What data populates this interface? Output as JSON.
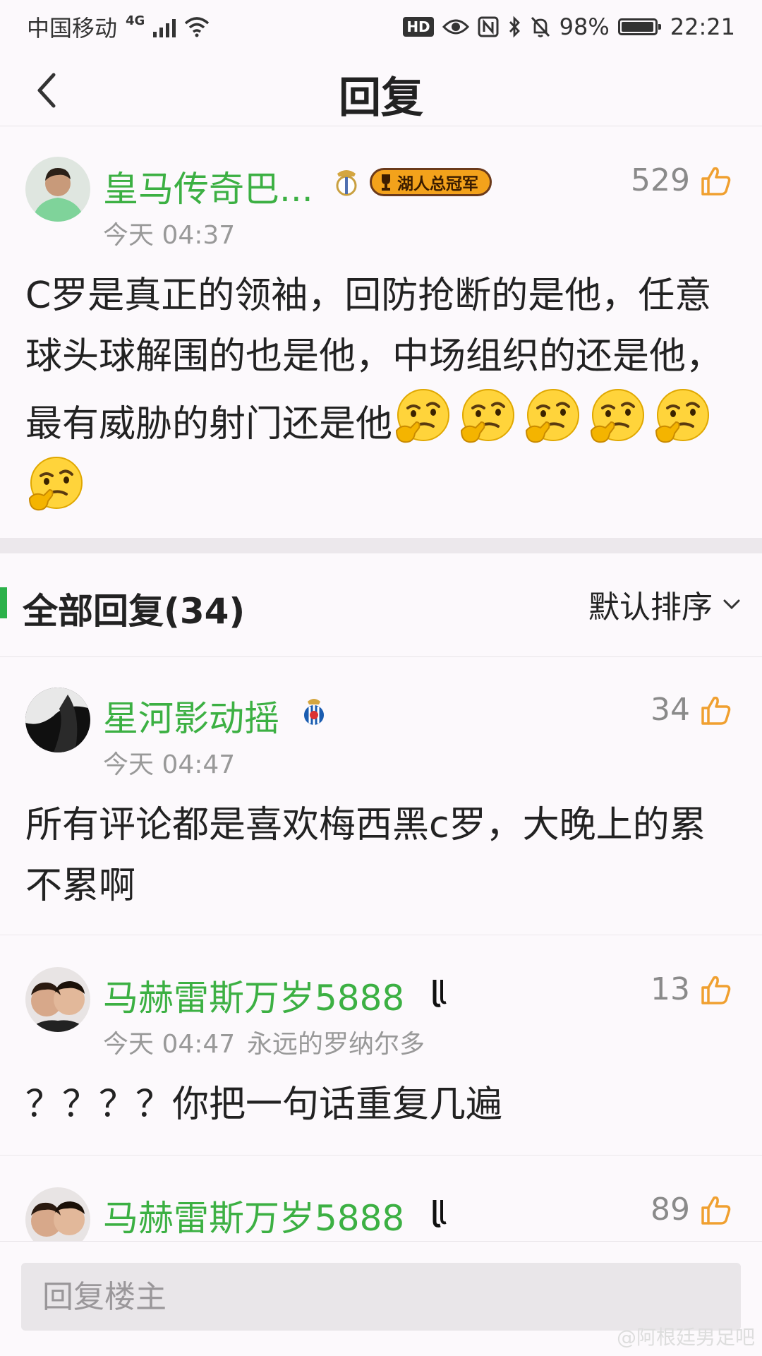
{
  "status": {
    "carrier": "中国移动",
    "network": "4G",
    "hd": "HD",
    "battery_pct": "98%",
    "battery_level": 0.98,
    "time": "22:21"
  },
  "header": {
    "title": "回复"
  },
  "post": {
    "user": "皇马传奇巴...",
    "badge": "湖人总冠军",
    "time": "今天 04:37",
    "likes": "529",
    "text": "C罗是真正的领袖，回防抢断的是他，任意球头球解围的也是他，中场组织的还是他，最有威胁的射门还是他",
    "emoji_count": 6
  },
  "section": {
    "title": "全部回复(34)",
    "sort_label": "默认排序"
  },
  "replies": [
    {
      "user": "星河影动摇",
      "time": "今天 04:47",
      "quote": "",
      "likes": "34",
      "text": "所有评论都是喜欢梅西黑c罗，大晚上的累不累啊"
    },
    {
      "user": "马赫雷斯万岁5888",
      "time": "今天 04:47",
      "quote": "永远的罗纳尔多",
      "likes": "13",
      "text": "？？？？你把一句话重复几遍"
    },
    {
      "user": "马赫雷斯万岁5888",
      "likes": "89"
    }
  ],
  "footer": {
    "placeholder": "回复楼主",
    "watermark": "@阿根廷男足吧"
  },
  "colors": {
    "username": "#3cb043",
    "accent": "#2cb14a",
    "like": "#f0a030"
  }
}
